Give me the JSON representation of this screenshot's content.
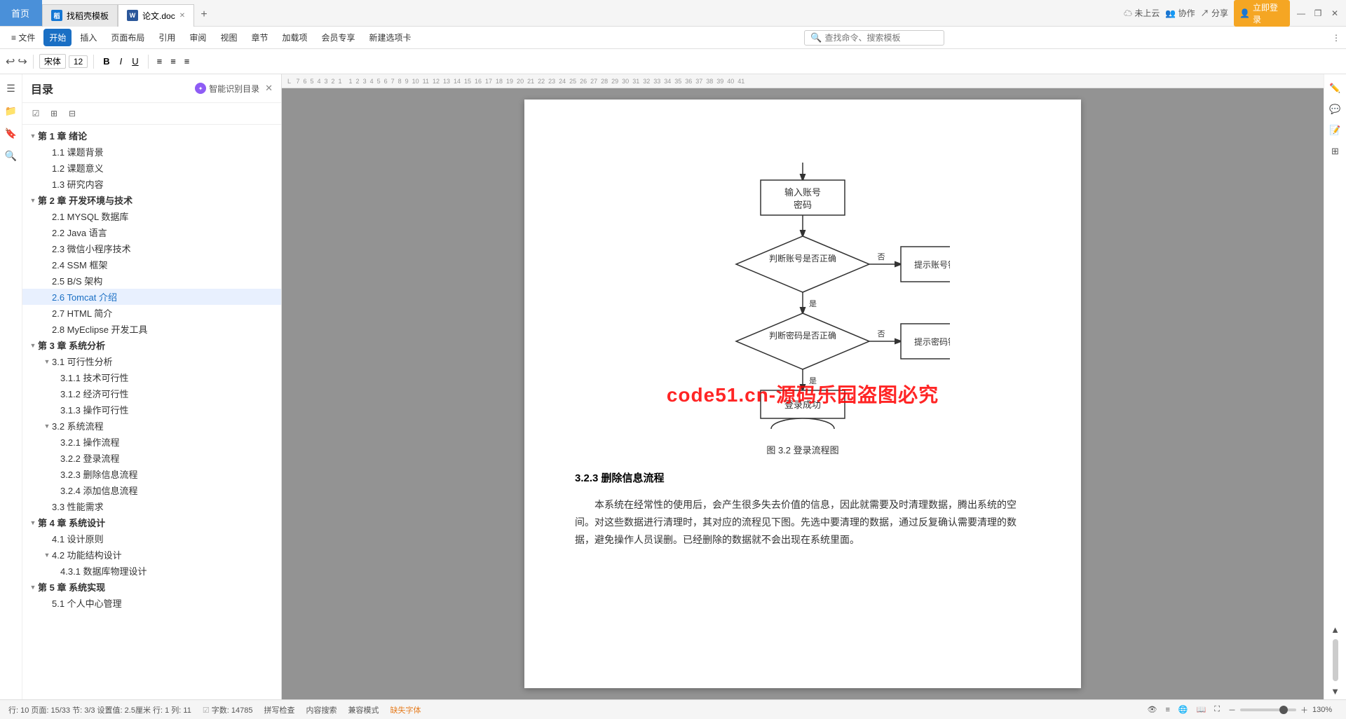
{
  "titlebar": {
    "tab_home": "首页",
    "tab_wps": "找稻壳模板",
    "tab_doc": "论文.doc",
    "tab_add": "+",
    "btn_register": "立即登录",
    "btn_minimize": "—",
    "btn_restore": "❐",
    "btn_close": "✕"
  },
  "toolbar": {
    "undo": "↩",
    "redo": "↪",
    "start_label": "开始",
    "insert_label": "插入",
    "layout_label": "页面布局",
    "cite_label": "引用",
    "review_label": "审阅",
    "view_label": "视图",
    "chapter_label": "章节",
    "addon_label": "加载项",
    "member_label": "会员专享",
    "newtab_label": "新建选项卡",
    "search_placeholder": "查找命令、搜索模板",
    "cloud_label": "未上云",
    "collab_label": "协作",
    "share_label": "分享"
  },
  "sidebar": {
    "title": "目录",
    "ai_btn": "智能识别目录",
    "close": "✕",
    "toc": [
      {
        "level": 1,
        "text": "第 1 章  绪论",
        "expanded": true
      },
      {
        "level": 2,
        "text": "1.1  课题背景",
        "expanded": false
      },
      {
        "level": 2,
        "text": "1.2  课题意义",
        "expanded": false
      },
      {
        "level": 2,
        "text": "1.3  研究内容",
        "expanded": false
      },
      {
        "level": 1,
        "text": "第 2 章  开发环境与技术",
        "expanded": true
      },
      {
        "level": 2,
        "text": "2.1  MYSQL 数据库",
        "expanded": false
      },
      {
        "level": 2,
        "text": "2.2  Java 语言",
        "expanded": false
      },
      {
        "level": 2,
        "text": "2.3  微信小程序技术",
        "expanded": false
      },
      {
        "level": 2,
        "text": "2.4  SSM 框架",
        "expanded": false
      },
      {
        "level": 2,
        "text": "2.5  B/S 架构",
        "expanded": false
      },
      {
        "level": 2,
        "text": "2.6  Tomcat 介绍",
        "expanded": false,
        "active": true
      },
      {
        "level": 2,
        "text": "2.7  HTML 简介",
        "expanded": false
      },
      {
        "level": 2,
        "text": "2.8  MyEclipse 开发工具",
        "expanded": false
      },
      {
        "level": 1,
        "text": "第 3 章  系统分析",
        "expanded": true
      },
      {
        "level": 2,
        "text": "3.1  可行性分析",
        "expanded": true
      },
      {
        "level": 3,
        "text": "3.1.1  技术可行性",
        "expanded": false
      },
      {
        "level": 3,
        "text": "3.1.2  经济可行性",
        "expanded": false
      },
      {
        "level": 3,
        "text": "3.1.3  操作可行性",
        "expanded": false
      },
      {
        "level": 2,
        "text": "3.2  系统流程",
        "expanded": true
      },
      {
        "level": 3,
        "text": "3.2.1  操作流程",
        "expanded": false
      },
      {
        "level": 3,
        "text": "3.2.2  登录流程",
        "expanded": false
      },
      {
        "level": 3,
        "text": "3.2.3  删除信息流程",
        "expanded": false
      },
      {
        "level": 3,
        "text": "3.2.4  添加信息流程",
        "expanded": false
      },
      {
        "level": 2,
        "text": "3.3  性能需求",
        "expanded": false
      },
      {
        "level": 1,
        "text": "第 4 章  系统设计",
        "expanded": true
      },
      {
        "level": 2,
        "text": "4.1  设计原则",
        "expanded": false
      },
      {
        "level": 2,
        "text": "4.2  功能结构设计",
        "expanded": true
      },
      {
        "level": 3,
        "text": "4.3.1  数据库物理设计",
        "expanded": false
      },
      {
        "level": 1,
        "text": "第 5 章  系统实现",
        "expanded": true
      },
      {
        "level": 2,
        "text": "5.1  个人中心管理",
        "expanded": false
      }
    ]
  },
  "document": {
    "flowchart_caption": "图 3.2  登录流程图",
    "section_title": "3.2.3  删除信息流程",
    "body_text": "本系统在经常性的使用后，会产生很多失去价值的信息，因此就需要及时清理数据，腾出系统的空间。对这些数据进行清理时，其对应的流程见下图。先选中要清理的数据，通过反复确认需要清理的数据，避免操作人员误删。已经删除的数据就不会出现在系统里面。",
    "flowchart_nodes": {
      "input_box": "输入账号\n密码",
      "check_account": "判断账号是否正确",
      "error_account": "提示账号错误",
      "check_password": "判断密码是否正确",
      "error_password": "提示密码错误",
      "success": "登录成功",
      "yes_label_1": "是",
      "no_label_1": "否",
      "yes_label_2": "是",
      "no_label_2": "否"
    },
    "watermark": "code51.cn-源码乐园盗图必究"
  },
  "statusbar": {
    "row_col": "行: 10  页面: 15/33  节: 3/3  设置值: 2.5厘米  行: 1  列: 11",
    "word_count": "字数: 14785",
    "spell_check": "拼写检查",
    "content_search": "内容搜索",
    "compat_mode": "兼容模式",
    "missing_font": "缺失字体",
    "zoom": "130%"
  }
}
